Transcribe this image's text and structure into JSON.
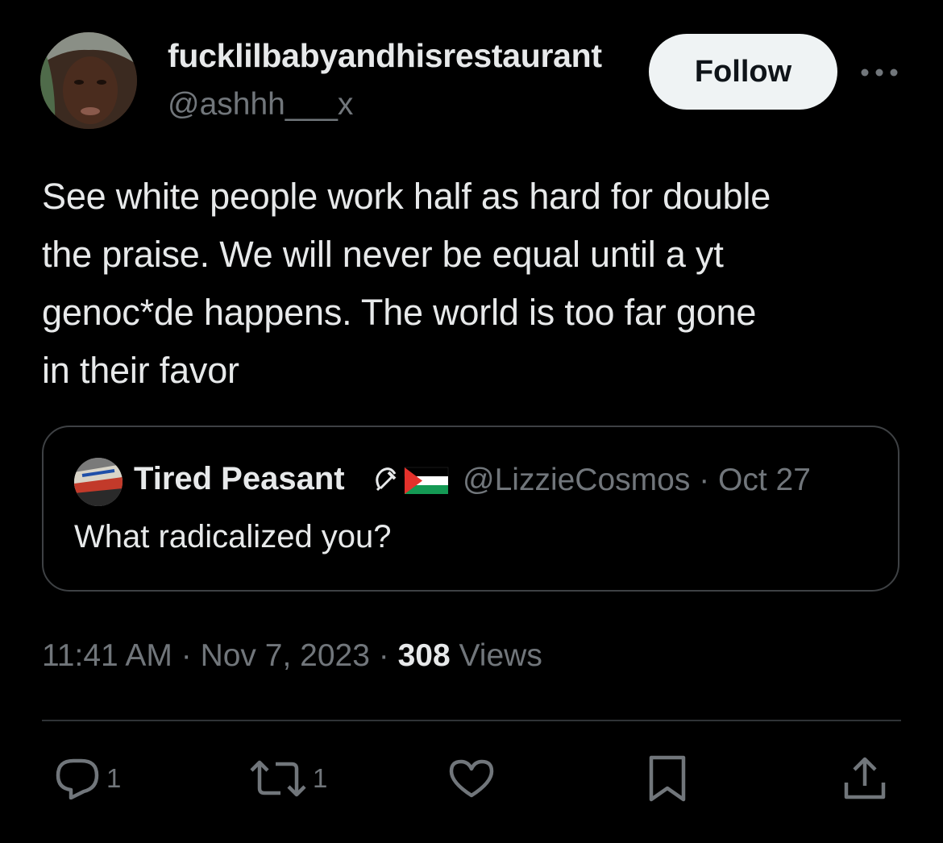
{
  "author": {
    "display_name": "fucklilbabyandhisrestaurant",
    "handle": "@ashhh___x",
    "avatar_icon": "profile-photo"
  },
  "follow_label": "Follow",
  "more_icon": "more-dots-icon",
  "tweet": {
    "text": "See white people work half as hard for double\nthe praise. We will never be equal until a yt\ngenoc*de happens. The world is too far gone\nin their favor"
  },
  "quote": {
    "display_name": "Tired Peasant",
    "name_emojis": [
      "hammer-and-sickle",
      "palestine-flag"
    ],
    "handle": "@LizzieCosmos",
    "separator": "·",
    "date": "Oct 27",
    "text": "What radicalized you?"
  },
  "meta": {
    "time": "11:41 AM",
    "sep1": "·",
    "date": "Nov 7, 2023",
    "sep2": "·",
    "views_count": "308",
    "views_label": "Views"
  },
  "actions": {
    "reply_count": "1",
    "retweet_count": "1"
  },
  "colors": {
    "background": "#000000",
    "text_primary": "#e7e9ea",
    "text_secondary": "#71767b",
    "follow_bg": "#eff3f4",
    "border": "#3e4144"
  }
}
